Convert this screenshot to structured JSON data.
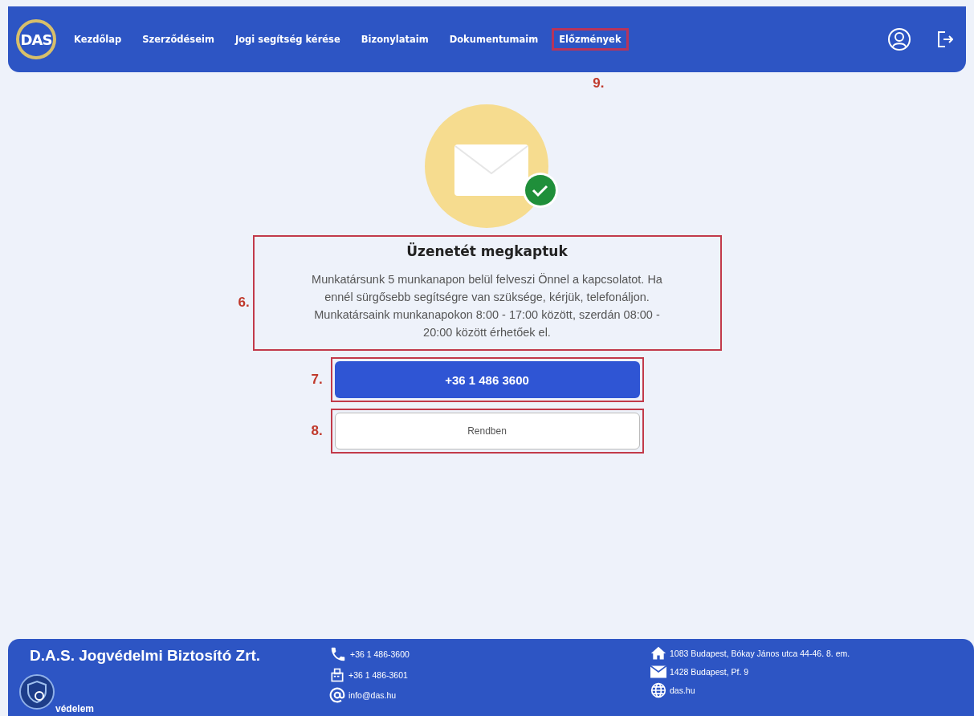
{
  "header": {
    "logo": "DAS",
    "nav": [
      {
        "label": "Kezdőlap"
      },
      {
        "label": "Szerződéseim"
      },
      {
        "label": "Jogi segítség kérése"
      },
      {
        "label": "Bizonylataim"
      },
      {
        "label": "Dokumentumaim"
      },
      {
        "label": "Előzmények",
        "annotation": "9."
      }
    ]
  },
  "message": {
    "annotation": "6.",
    "title": "Üzenetét megkaptuk",
    "body": "Munkatársunk 5 munkanapon belül felveszi Önnel a kapcsolatot. Ha ennél sürgősebb segítségre van szüksége, kérjük, telefonáljon. Munkatársaink munkanapokon 8:00 - 17:00 között, szerdán 08:00 - 20:00 között érhetőek el."
  },
  "buttons": [
    {
      "label": "+36 1 486 3600",
      "kind": "primary",
      "annotation": "7."
    },
    {
      "label": "Rendben",
      "kind": "secondary",
      "annotation": "8."
    }
  ],
  "footer": {
    "company": "D.A.S. Jogvédelmi Biztosító Zrt.",
    "badge_text": "védelem",
    "contacts": [
      {
        "kind": "phone",
        "text": "+36 1 486-3600"
      },
      {
        "kind": "fax",
        "text": "+36 1 486-3601"
      },
      {
        "kind": "email",
        "text": "info@das.hu"
      }
    ],
    "addresses": [
      {
        "kind": "home",
        "text": "1083 Budapest, Bókay János utca 44-46. 8. em."
      },
      {
        "kind": "mail",
        "text": "1428 Budapest, Pf. 9"
      },
      {
        "kind": "web",
        "text": "das.hu"
      }
    ]
  }
}
